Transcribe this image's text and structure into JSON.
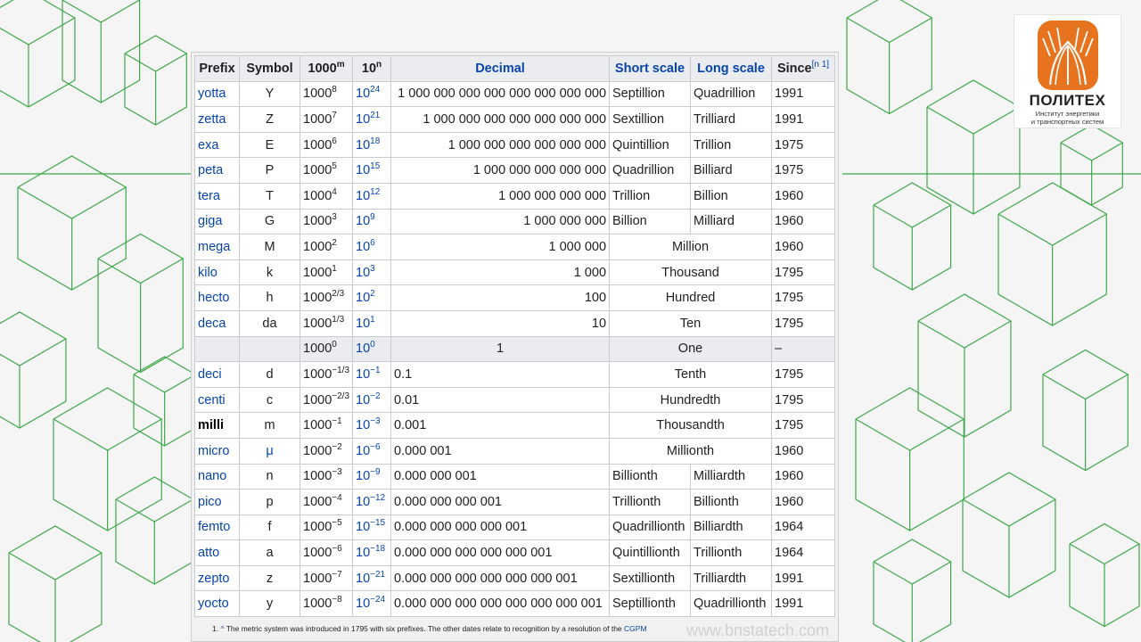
{
  "colors": {
    "line": "#3fa84a",
    "link": "#0645ad",
    "header_bg": "#eaecf0",
    "logo_orange": "#e8731e"
  },
  "logo": {
    "title": "ПОЛИТЕХ",
    "sub1": "Институт энергетики",
    "sub2": "и транспортных систем"
  },
  "headers": {
    "prefix": "Prefix",
    "symbol": "Symbol",
    "pow_base": "1000",
    "pow_exp": "m",
    "ten_base": "10",
    "ten_exp": "n",
    "decimal": "Decimal",
    "short": "Short scale",
    "long": "Long scale",
    "since": "Since",
    "since_ref": "[n 1]"
  },
  "rows": [
    {
      "prefix": "yotta",
      "symbol": "Y",
      "pow": "8",
      "ten": "24",
      "decimal": "1 000 000 000 000 000 000 000 000",
      "short": "Septillion",
      "long": "Quadrillion",
      "since": "1991"
    },
    {
      "prefix": "zetta",
      "symbol": "Z",
      "pow": "7",
      "ten": "21",
      "decimal": "1 000 000 000 000 000 000 000",
      "short": "Sextillion",
      "long": "Trilliard",
      "since": "1991"
    },
    {
      "prefix": "exa",
      "symbol": "E",
      "pow": "6",
      "ten": "18",
      "decimal": "1 000 000 000 000 000 000",
      "short": "Quintillion",
      "long": "Trillion",
      "since": "1975"
    },
    {
      "prefix": "peta",
      "symbol": "P",
      "pow": "5",
      "ten": "15",
      "decimal": "1 000 000 000 000 000",
      "short": "Quadrillion",
      "long": "Billiard",
      "since": "1975"
    },
    {
      "prefix": "tera",
      "symbol": "T",
      "pow": "4",
      "ten": "12",
      "decimal": "1 000 000 000 000",
      "short": "Trillion",
      "long": "Billion",
      "since": "1960"
    },
    {
      "prefix": "giga",
      "symbol": "G",
      "pow": "3",
      "ten": "9",
      "decimal": "1 000 000 000",
      "short": "Billion",
      "long": "Milliard",
      "since": "1960"
    },
    {
      "prefix": "mega",
      "symbol": "M",
      "pow": "2",
      "ten": "6",
      "decimal": "1 000 000",
      "scale": "Million",
      "since": "1960"
    },
    {
      "prefix": "kilo",
      "symbol": "k",
      "pow": "1",
      "ten": "3",
      "decimal": "1 000",
      "scale": "Thousand",
      "since": "1795"
    },
    {
      "prefix": "hecto",
      "symbol": "h",
      "pow": "2/3",
      "ten": "2",
      "decimal": "100",
      "scale": "Hundred",
      "since": "1795"
    },
    {
      "prefix": "deca",
      "symbol": "da",
      "pow": "1/3",
      "ten": "1",
      "decimal": "10",
      "scale": "Ten",
      "since": "1795"
    },
    {
      "prefix": "",
      "symbol": "",
      "pow": "0",
      "ten": "0",
      "decimal": "1",
      "scale": "One",
      "since": "–"
    },
    {
      "prefix": "deci",
      "symbol": "d",
      "pow": "−1/3",
      "ten": "−1",
      "decimal": "0.1",
      "scale": "Tenth",
      "since": "1795"
    },
    {
      "prefix": "centi",
      "symbol": "c",
      "pow": "−2/3",
      "ten": "−2",
      "decimal": "0.01",
      "scale": "Hundredth",
      "since": "1795"
    },
    {
      "prefix": "milli",
      "symbol": "m",
      "pow": "−1",
      "ten": "−3",
      "decimal": "0.001",
      "scale": "Thousandth",
      "since": "1795"
    },
    {
      "prefix": "micro",
      "symbol": "μ",
      "pow": "−2",
      "ten": "−6",
      "decimal": "0.000 001",
      "scale": "Millionth",
      "since": "1960"
    },
    {
      "prefix": "nano",
      "symbol": "n",
      "pow": "−3",
      "ten": "−9",
      "decimal": "0.000 000 001",
      "short": "Billionth",
      "long": "Milliardth",
      "since": "1960"
    },
    {
      "prefix": "pico",
      "symbol": "p",
      "pow": "−4",
      "ten": "−12",
      "decimal": "0.000 000 000 001",
      "short": "Trillionth",
      "long": "Billionth",
      "since": "1960"
    },
    {
      "prefix": "femto",
      "symbol": "f",
      "pow": "−5",
      "ten": "−15",
      "decimal": "0.000 000 000 000 001",
      "short": "Quadrillionth",
      "long": "Billiardth",
      "since": "1964"
    },
    {
      "prefix": "atto",
      "symbol": "a",
      "pow": "−6",
      "ten": "−18",
      "decimal": "0.000 000 000 000 000 001",
      "short": "Quintillionth",
      "long": "Trillionth",
      "since": "1964"
    },
    {
      "prefix": "zepto",
      "symbol": "z",
      "pow": "−7",
      "ten": "−21",
      "decimal": "0.000 000 000 000 000 000 001",
      "short": "Sextillionth",
      "long": "Trilliardth",
      "since": "1991"
    },
    {
      "prefix": "yocto",
      "symbol": "y",
      "pow": "−8",
      "ten": "−24",
      "decimal": "0.000 000 000 000 000 000 000 001",
      "short": "Septillionth",
      "long": "Quadrillionth",
      "since": "1991"
    }
  ],
  "note": {
    "number": "1.",
    "caret": "^",
    "text": "The metric system was introduced in 1795 with six prefixes. The other dates relate to recognition by a resolution of the",
    "ref": "CGPM"
  },
  "watermark": "www.bnstatech.com"
}
